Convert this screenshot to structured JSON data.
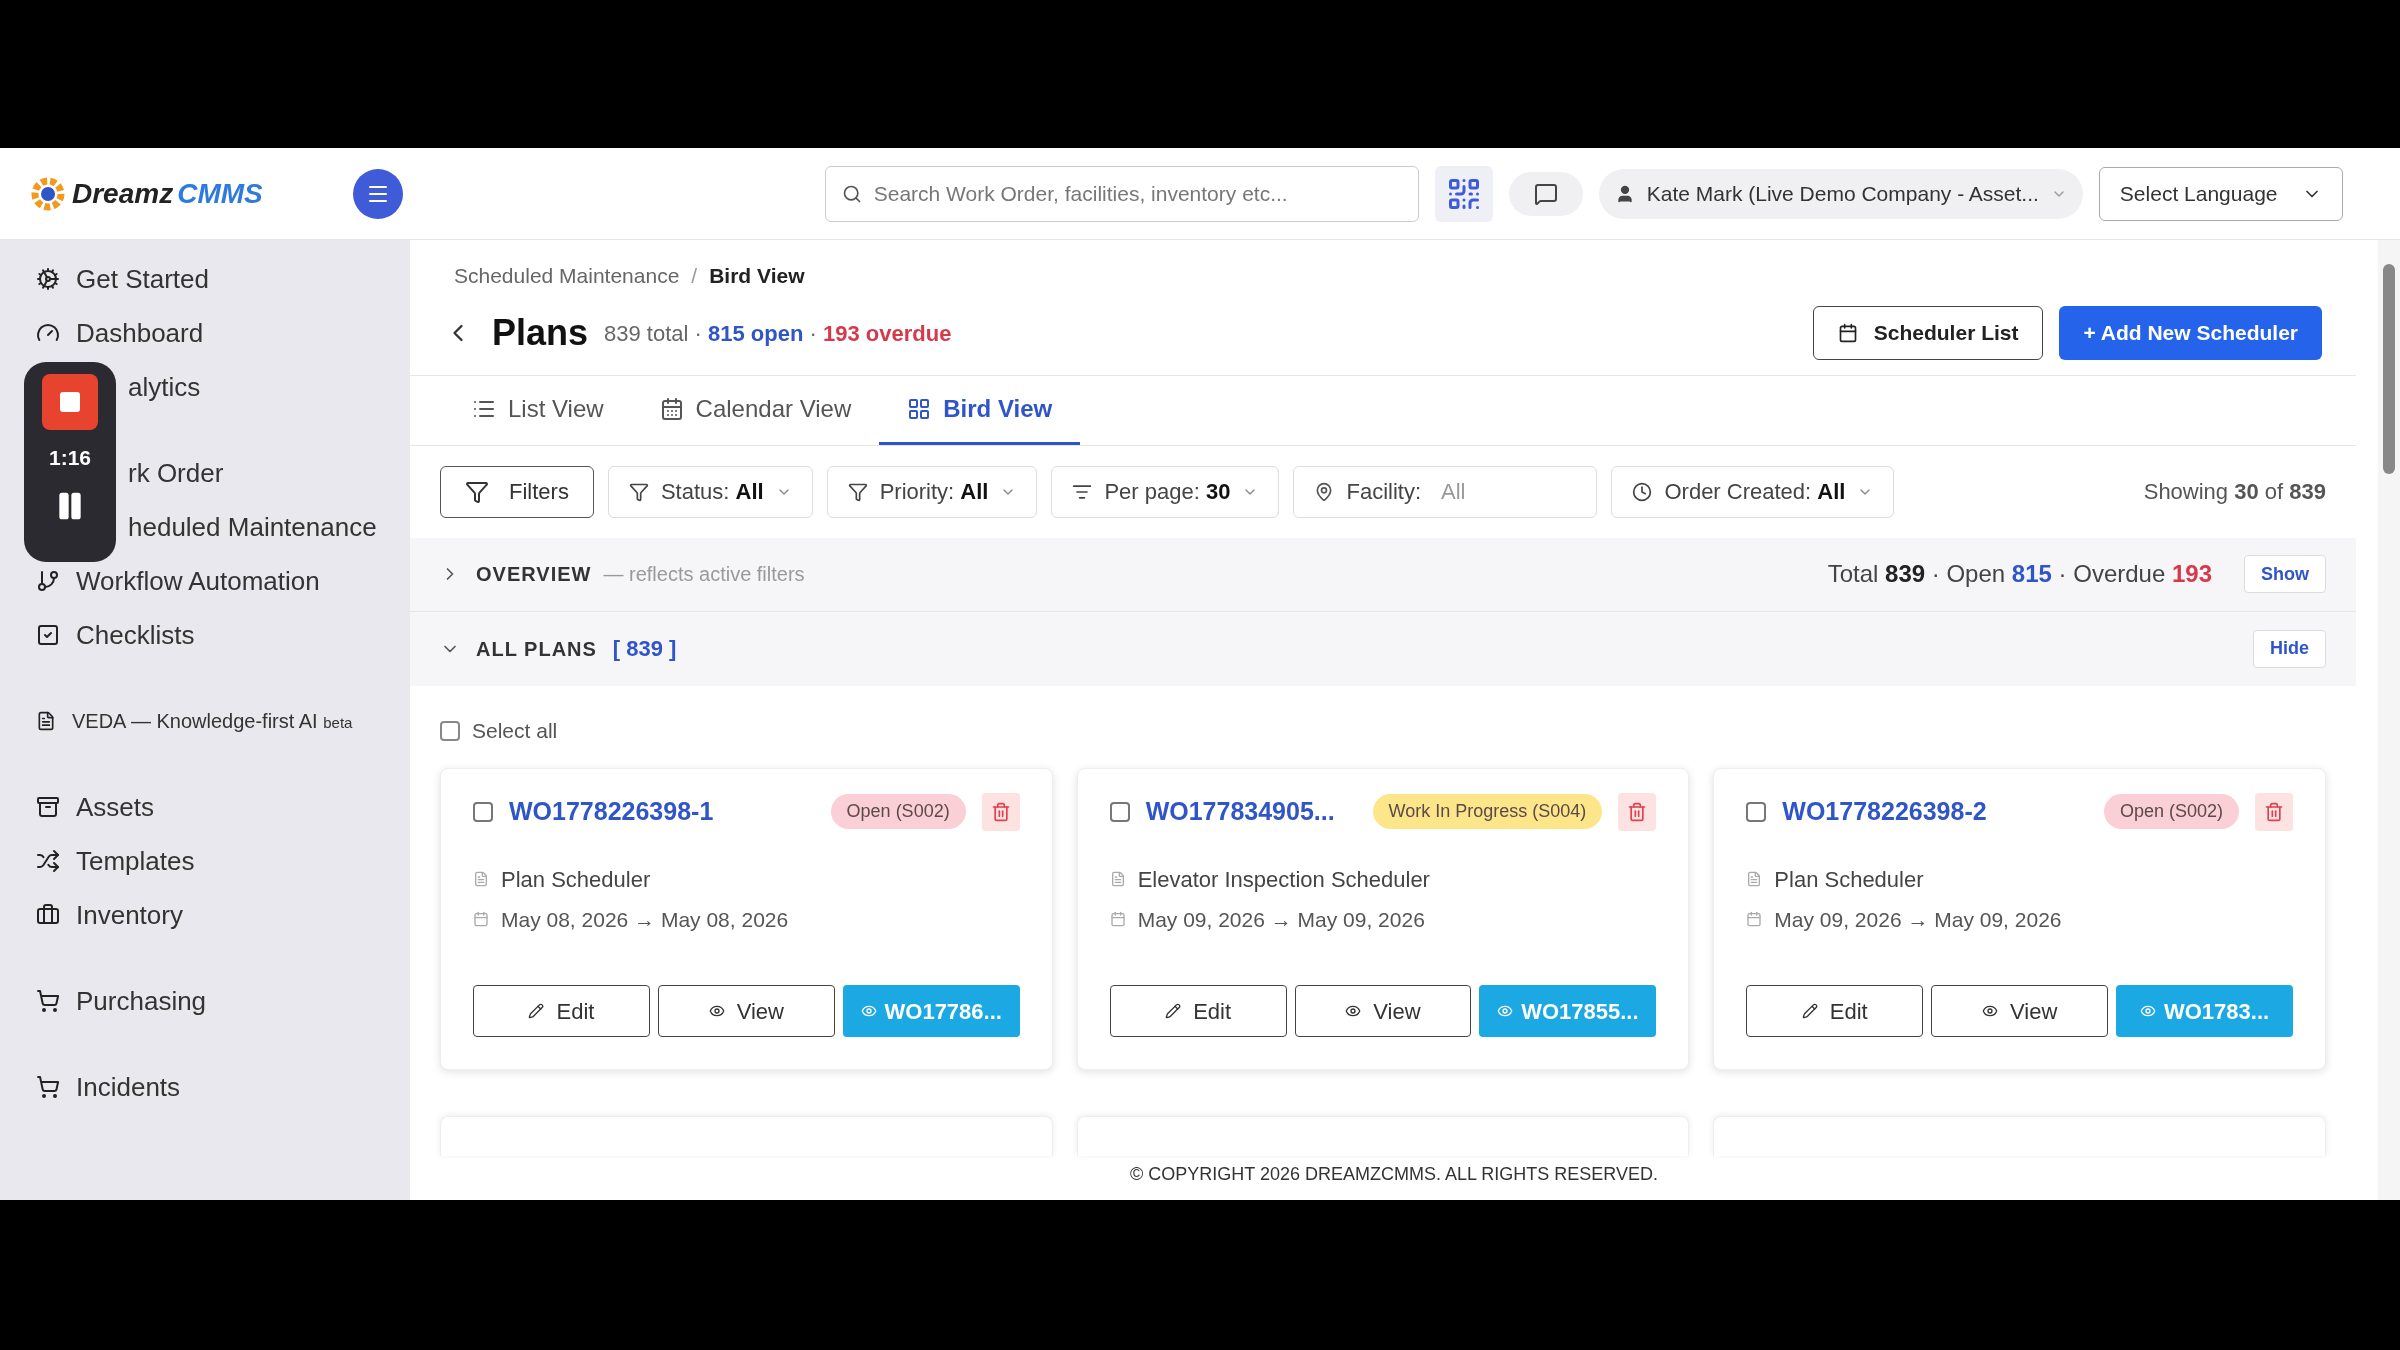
{
  "logo": {
    "word_1": "Dreamz",
    "word_2": "CMMS"
  },
  "search": {
    "placeholder": "Search Work Order, facilities, inventory etc..."
  },
  "user": {
    "label": "Kate Mark (Live Demo Company - Asset..."
  },
  "language": {
    "value": "Select Language"
  },
  "sidebar": {
    "groups": [
      [
        {
          "label": "Get Started",
          "kind": "link"
        },
        {
          "label": "Dashboard",
          "kind": "link"
        },
        {
          "label": "alytics",
          "kind": "covered"
        }
      ],
      [
        {
          "label": "rk Order",
          "kind": "covered"
        },
        {
          "label": "heduled Maintenance",
          "kind": "covered"
        },
        {
          "label": "Workflow Automation",
          "kind": "link"
        },
        {
          "label": "Checklists",
          "kind": "link"
        }
      ],
      [
        {
          "label": "VEDA — Knowledge-first AI",
          "badge": "beta",
          "kind": "ai"
        }
      ],
      [
        {
          "label": "Assets",
          "kind": "link"
        },
        {
          "label": "Templates",
          "kind": "link"
        },
        {
          "label": "Inventory",
          "kind": "link"
        }
      ],
      [
        {
          "label": "Purchasing",
          "kind": "link"
        }
      ],
      [
        {
          "label": "Incidents",
          "kind": "link"
        }
      ]
    ]
  },
  "recorder": {
    "time": "1:16"
  },
  "breadcrumb_separator": "/",
  "breadcrumb": [
    {
      "label": "Scheduled Maintenance",
      "selected": false
    },
    {
      "label": "Bird View",
      "selected": true
    }
  ],
  "title": "Plans",
  "stats": {
    "total": "839 total",
    "sep_1": "·",
    "open": "815 open",
    "sep_2": "·",
    "overdue": "193 overdue"
  },
  "header_buttons": [
    {
      "label": "Scheduler List",
      "kind": "outline"
    },
    {
      "label": "+ Add New Scheduler",
      "kind": "primary"
    }
  ],
  "tabs": [
    {
      "label": "List View",
      "selected": false
    },
    {
      "label": "Calendar View",
      "selected": false
    },
    {
      "label": "Bird View",
      "selected": true
    }
  ],
  "filters": [
    {
      "kind": "button",
      "label": "Filters"
    },
    {
      "kind": "status",
      "label": "Status:",
      "value": "All"
    },
    {
      "kind": "priority",
      "label": "Priority:",
      "value": "All"
    },
    {
      "kind": "perpage",
      "label": "Per page:",
      "value": "30"
    },
    {
      "kind": "facility",
      "label": "Facility:",
      "placeholder": "All"
    },
    {
      "kind": "created",
      "label": "Order Created:",
      "value": "All"
    }
  ],
  "showing": "Showing **30** of **839**",
  "overview": {
    "expanded": false,
    "title": "OVERVIEW",
    "note": "— reflects active filters",
    "total_label": "Total",
    "total": "839",
    "open_label": "Open",
    "open": "815",
    "overdue_label": "Overdue",
    "overdue": "193",
    "sep": "·",
    "button": "Show"
  },
  "all_plans": {
    "expanded": true,
    "title": "ALL PLANS",
    "count": "[ 839 ]",
    "button": "Hide"
  },
  "select_all": {
    "label": "Select all",
    "checked": false
  },
  "cards": [
    {
      "checked": false,
      "title": "WO1778226398-1",
      "status": {
        "label": "Open (S002)",
        "color": "#fbcfd6"
      },
      "description": "Plan Scheduler",
      "dates": "May 08, 2026 → May 08, 2026",
      "buttons": [
        "Edit",
        "View",
        "WO17786..."
      ]
    },
    {
      "checked": false,
      "title": "WO177834905...",
      "status": {
        "label": "Work In Progress (S004)",
        "color": "#fde68a"
      },
      "description": "Elevator Inspection Scheduler",
      "dates": "May 09, 2026 → May 09, 2026",
      "buttons": [
        "Edit",
        "View",
        "WO17855..."
      ]
    },
    {
      "checked": false,
      "title": "WO1778226398-2",
      "status": {
        "label": "Open (S002)",
        "color": "#fbcfd6"
      },
      "description": "Plan Scheduler",
      "dates": "May 09, 2026 → May 09, 2026",
      "buttons": [
        "Edit",
        "View",
        "WO1783..."
      ]
    }
  ],
  "footer": "© COPYRIGHT 2026 DREAMZCMMS. ALL RIGHTS RESERVED."
}
